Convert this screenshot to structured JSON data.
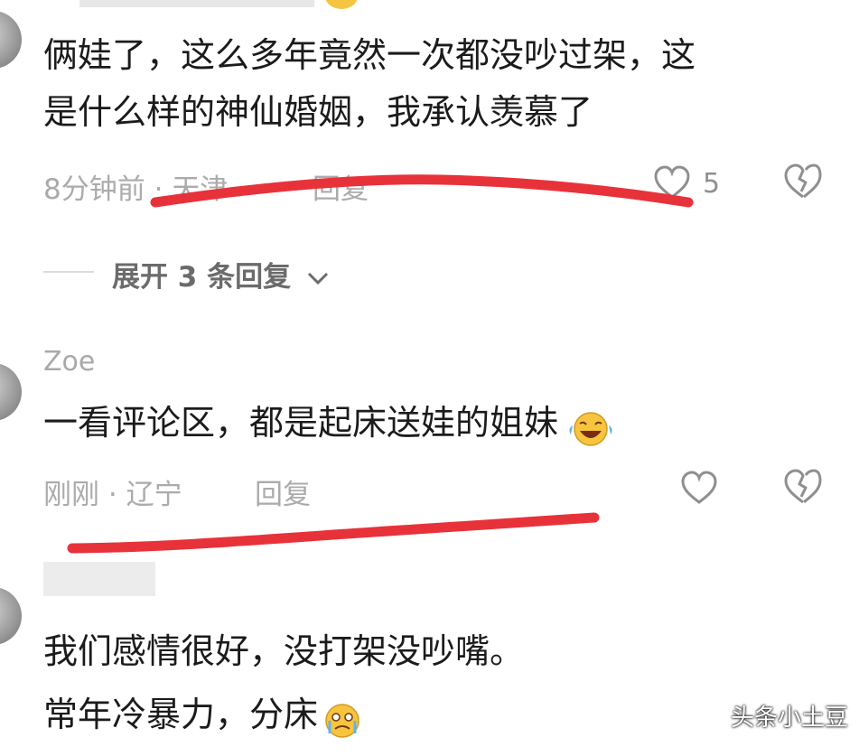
{
  "comments": [
    {
      "content_lines": [
        "俩娃了，这么多年竟然一次都没吵过架，这",
        "是什么样的神仙婚姻，我承认羡慕了"
      ],
      "time": "8分钟前",
      "location": "天津",
      "reply_label": "回复",
      "like_count": "5",
      "expand_label": "展开 3 条回复"
    },
    {
      "username": "Zoe",
      "content": "一看评论区，都是起床送娃的姐妹",
      "emoji": "laughing-tears-emoji",
      "time": "刚刚",
      "location": "辽宁",
      "reply_label": "回复"
    },
    {
      "content_lines": [
        "我们感情很好，没打架没吵嘴。",
        "常年冷暴力，分床"
      ],
      "emoji": "crying-emoji"
    }
  ],
  "watermark": "头条小土豆",
  "annotation_color": "#e8323a"
}
